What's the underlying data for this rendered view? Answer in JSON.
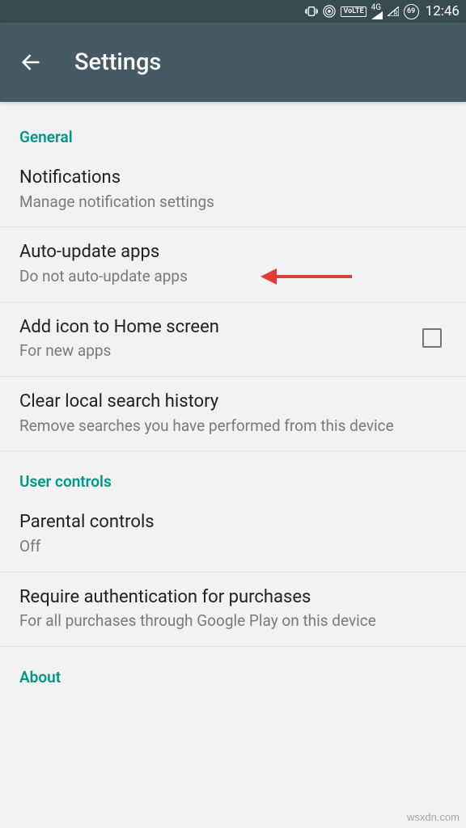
{
  "status_bar": {
    "volte": "VoLTE",
    "net_type": "4G",
    "net_sub": "R",
    "battery": "69",
    "time": "12:46"
  },
  "app_bar": {
    "title": "Settings"
  },
  "sections": {
    "general": {
      "header": "General",
      "notifications": {
        "title": "Notifications",
        "sub": "Manage notification settings"
      },
      "auto_update": {
        "title": "Auto-update apps",
        "sub": "Do not auto-update apps"
      },
      "add_icon": {
        "title": "Add icon to Home screen",
        "sub": "For new apps"
      },
      "clear_search": {
        "title": "Clear local search history",
        "sub": "Remove searches you have performed from this device"
      }
    },
    "user_controls": {
      "header": "User controls",
      "parental": {
        "title": "Parental controls",
        "sub": "Off"
      },
      "auth": {
        "title": "Require authentication for purchases",
        "sub": "For all purchases through Google Play on this device"
      }
    },
    "about": {
      "header": "About"
    }
  },
  "watermark": "wsxdn.com"
}
